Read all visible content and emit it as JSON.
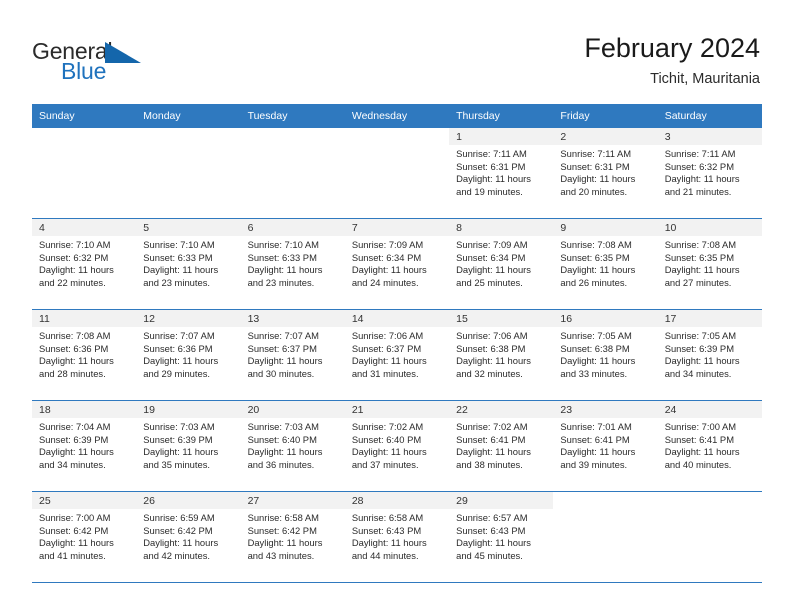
{
  "brand": {
    "name_part1": "General",
    "name_part2": "Blue",
    "triangle_icon": "brand-triangle-icon",
    "colors": {
      "dark": "#2b2b2b",
      "blue": "#1f72bd",
      "header_blue": "#2f79bf",
      "strip_gray": "#f2f2f2"
    }
  },
  "header": {
    "title": "February 2024",
    "subtitle": "Tichit, Mauritania"
  },
  "weekdays": [
    "Sunday",
    "Monday",
    "Tuesday",
    "Wednesday",
    "Thursday",
    "Friday",
    "Saturday"
  ],
  "weeks": [
    [
      {
        "day": "",
        "sunrise": "",
        "sunset": "",
        "daylight1": "",
        "daylight2": "",
        "blank": true
      },
      {
        "day": "",
        "sunrise": "",
        "sunset": "",
        "daylight1": "",
        "daylight2": "",
        "blank": true
      },
      {
        "day": "",
        "sunrise": "",
        "sunset": "",
        "daylight1": "",
        "daylight2": "",
        "blank": true
      },
      {
        "day": "",
        "sunrise": "",
        "sunset": "",
        "daylight1": "",
        "daylight2": "",
        "blank": true
      },
      {
        "day": "1",
        "sunrise": "Sunrise: 7:11 AM",
        "sunset": "Sunset: 6:31 PM",
        "daylight1": "Daylight: 11 hours",
        "daylight2": "and 19 minutes."
      },
      {
        "day": "2",
        "sunrise": "Sunrise: 7:11 AM",
        "sunset": "Sunset: 6:31 PM",
        "daylight1": "Daylight: 11 hours",
        "daylight2": "and 20 minutes."
      },
      {
        "day": "3",
        "sunrise": "Sunrise: 7:11 AM",
        "sunset": "Sunset: 6:32 PM",
        "daylight1": "Daylight: 11 hours",
        "daylight2": "and 21 minutes."
      }
    ],
    [
      {
        "day": "4",
        "sunrise": "Sunrise: 7:10 AM",
        "sunset": "Sunset: 6:32 PM",
        "daylight1": "Daylight: 11 hours",
        "daylight2": "and 22 minutes."
      },
      {
        "day": "5",
        "sunrise": "Sunrise: 7:10 AM",
        "sunset": "Sunset: 6:33 PM",
        "daylight1": "Daylight: 11 hours",
        "daylight2": "and 23 minutes."
      },
      {
        "day": "6",
        "sunrise": "Sunrise: 7:10 AM",
        "sunset": "Sunset: 6:33 PM",
        "daylight1": "Daylight: 11 hours",
        "daylight2": "and 23 minutes."
      },
      {
        "day": "7",
        "sunrise": "Sunrise: 7:09 AM",
        "sunset": "Sunset: 6:34 PM",
        "daylight1": "Daylight: 11 hours",
        "daylight2": "and 24 minutes."
      },
      {
        "day": "8",
        "sunrise": "Sunrise: 7:09 AM",
        "sunset": "Sunset: 6:34 PM",
        "daylight1": "Daylight: 11 hours",
        "daylight2": "and 25 minutes."
      },
      {
        "day": "9",
        "sunrise": "Sunrise: 7:08 AM",
        "sunset": "Sunset: 6:35 PM",
        "daylight1": "Daylight: 11 hours",
        "daylight2": "and 26 minutes."
      },
      {
        "day": "10",
        "sunrise": "Sunrise: 7:08 AM",
        "sunset": "Sunset: 6:35 PM",
        "daylight1": "Daylight: 11 hours",
        "daylight2": "and 27 minutes."
      }
    ],
    [
      {
        "day": "11",
        "sunrise": "Sunrise: 7:08 AM",
        "sunset": "Sunset: 6:36 PM",
        "daylight1": "Daylight: 11 hours",
        "daylight2": "and 28 minutes."
      },
      {
        "day": "12",
        "sunrise": "Sunrise: 7:07 AM",
        "sunset": "Sunset: 6:36 PM",
        "daylight1": "Daylight: 11 hours",
        "daylight2": "and 29 minutes."
      },
      {
        "day": "13",
        "sunrise": "Sunrise: 7:07 AM",
        "sunset": "Sunset: 6:37 PM",
        "daylight1": "Daylight: 11 hours",
        "daylight2": "and 30 minutes."
      },
      {
        "day": "14",
        "sunrise": "Sunrise: 7:06 AM",
        "sunset": "Sunset: 6:37 PM",
        "daylight1": "Daylight: 11 hours",
        "daylight2": "and 31 minutes."
      },
      {
        "day": "15",
        "sunrise": "Sunrise: 7:06 AM",
        "sunset": "Sunset: 6:38 PM",
        "daylight1": "Daylight: 11 hours",
        "daylight2": "and 32 minutes."
      },
      {
        "day": "16",
        "sunrise": "Sunrise: 7:05 AM",
        "sunset": "Sunset: 6:38 PM",
        "daylight1": "Daylight: 11 hours",
        "daylight2": "and 33 minutes."
      },
      {
        "day": "17",
        "sunrise": "Sunrise: 7:05 AM",
        "sunset": "Sunset: 6:39 PM",
        "daylight1": "Daylight: 11 hours",
        "daylight2": "and 34 minutes."
      }
    ],
    [
      {
        "day": "18",
        "sunrise": "Sunrise: 7:04 AM",
        "sunset": "Sunset: 6:39 PM",
        "daylight1": "Daylight: 11 hours",
        "daylight2": "and 34 minutes."
      },
      {
        "day": "19",
        "sunrise": "Sunrise: 7:03 AM",
        "sunset": "Sunset: 6:39 PM",
        "daylight1": "Daylight: 11 hours",
        "daylight2": "and 35 minutes."
      },
      {
        "day": "20",
        "sunrise": "Sunrise: 7:03 AM",
        "sunset": "Sunset: 6:40 PM",
        "daylight1": "Daylight: 11 hours",
        "daylight2": "and 36 minutes."
      },
      {
        "day": "21",
        "sunrise": "Sunrise: 7:02 AM",
        "sunset": "Sunset: 6:40 PM",
        "daylight1": "Daylight: 11 hours",
        "daylight2": "and 37 minutes."
      },
      {
        "day": "22",
        "sunrise": "Sunrise: 7:02 AM",
        "sunset": "Sunset: 6:41 PM",
        "daylight1": "Daylight: 11 hours",
        "daylight2": "and 38 minutes."
      },
      {
        "day": "23",
        "sunrise": "Sunrise: 7:01 AM",
        "sunset": "Sunset: 6:41 PM",
        "daylight1": "Daylight: 11 hours",
        "daylight2": "and 39 minutes."
      },
      {
        "day": "24",
        "sunrise": "Sunrise: 7:00 AM",
        "sunset": "Sunset: 6:41 PM",
        "daylight1": "Daylight: 11 hours",
        "daylight2": "and 40 minutes."
      }
    ],
    [
      {
        "day": "25",
        "sunrise": "Sunrise: 7:00 AM",
        "sunset": "Sunset: 6:42 PM",
        "daylight1": "Daylight: 11 hours",
        "daylight2": "and 41 minutes."
      },
      {
        "day": "26",
        "sunrise": "Sunrise: 6:59 AM",
        "sunset": "Sunset: 6:42 PM",
        "daylight1": "Daylight: 11 hours",
        "daylight2": "and 42 minutes."
      },
      {
        "day": "27",
        "sunrise": "Sunrise: 6:58 AM",
        "sunset": "Sunset: 6:42 PM",
        "daylight1": "Daylight: 11 hours",
        "daylight2": "and 43 minutes."
      },
      {
        "day": "28",
        "sunrise": "Sunrise: 6:58 AM",
        "sunset": "Sunset: 6:43 PM",
        "daylight1": "Daylight: 11 hours",
        "daylight2": "and 44 minutes."
      },
      {
        "day": "29",
        "sunrise": "Sunrise: 6:57 AM",
        "sunset": "Sunset: 6:43 PM",
        "daylight1": "Daylight: 11 hours",
        "daylight2": "and 45 minutes."
      },
      {
        "day": "",
        "sunrise": "",
        "sunset": "",
        "daylight1": "",
        "daylight2": "",
        "blank": true
      },
      {
        "day": "",
        "sunrise": "",
        "sunset": "",
        "daylight1": "",
        "daylight2": "",
        "blank": true
      }
    ]
  ]
}
